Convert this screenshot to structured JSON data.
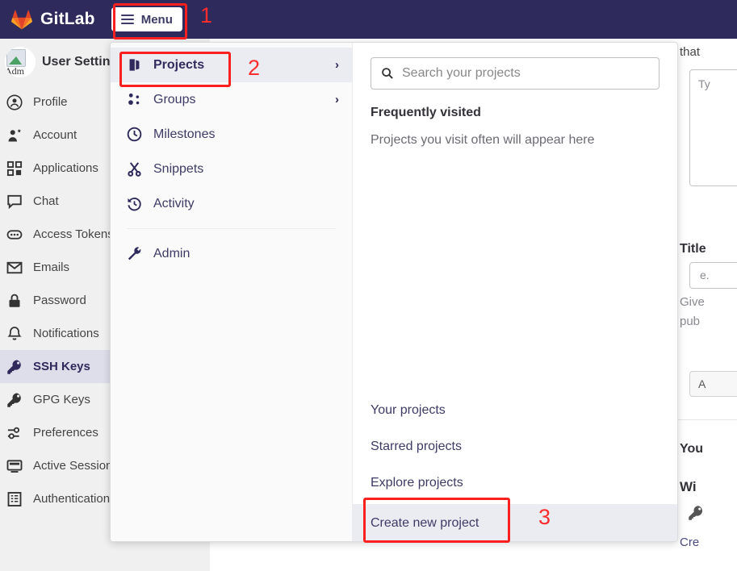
{
  "navbar": {
    "brand": "GitLab",
    "logo_icon": "gitlab-tanuki-icon",
    "menu_label": "Menu",
    "menu_icon": "hamburger-icon",
    "bg_color": "#2e2a5b"
  },
  "annotations": [
    {
      "label": "1",
      "target": "menu-button"
    },
    {
      "label": "2",
      "target": "projects-menu-item"
    },
    {
      "label": "3",
      "target": "create-new-project-link"
    }
  ],
  "sidebar": {
    "title": "User Settings",
    "avatar_alt": "Adm",
    "items": [
      {
        "label": "Profile",
        "icon": "user-circle-icon",
        "active": false
      },
      {
        "label": "Account",
        "icon": "account-gear-icon",
        "active": false
      },
      {
        "label": "Applications",
        "icon": "applications-grid-icon",
        "active": false
      },
      {
        "label": "Chat",
        "icon": "chat-bubble-icon",
        "active": false
      },
      {
        "label": "Access Tokens",
        "icon": "token-icon",
        "active": false
      },
      {
        "label": "Emails",
        "icon": "envelope-icon",
        "active": false
      },
      {
        "label": "Password",
        "icon": "lock-icon",
        "active": false
      },
      {
        "label": "Notifications",
        "icon": "bell-icon",
        "active": false
      },
      {
        "label": "SSH Keys",
        "icon": "key-icon",
        "active": true
      },
      {
        "label": "GPG Keys",
        "icon": "key-icon",
        "active": false
      },
      {
        "label": "Preferences",
        "icon": "sliders-icon",
        "active": false
      },
      {
        "label": "Active Sessions",
        "icon": "monitor-icon",
        "active": false
      },
      {
        "label": "Authentication log",
        "icon": "log-list-icon",
        "active": false
      }
    ]
  },
  "dropdown": {
    "left_items": [
      {
        "label": "Projects",
        "icon": "projects-icon",
        "chevron": "›",
        "selected": true
      },
      {
        "label": "Groups",
        "icon": "groups-icon",
        "chevron": "›",
        "selected": false
      },
      {
        "label": "Milestones",
        "icon": "clock-icon",
        "chevron": "",
        "selected": false
      },
      {
        "label": "Snippets",
        "icon": "scissors-icon",
        "chevron": "",
        "selected": false
      },
      {
        "label": "Activity",
        "icon": "history-icon",
        "chevron": "",
        "selected": false
      }
    ],
    "admin_item": {
      "label": "Admin",
      "icon": "wrench-icon"
    },
    "search": {
      "placeholder": "Search your projects",
      "value": "",
      "icon": "search-icon"
    },
    "frequently_visited_title": "Frequently visited",
    "frequently_visited_empty": "Projects you visit often will appear here",
    "bottom_links": [
      {
        "label": "Your projects",
        "highlighted": false
      },
      {
        "label": "Starred projects",
        "highlighted": false
      },
      {
        "label": "Explore projects",
        "highlighted": false
      }
    ],
    "create_link": {
      "label": "Create new project",
      "highlighted": true
    }
  },
  "page_right": {
    "line_that": "that",
    "textarea_placeholder": "Ty",
    "title_label": "Title",
    "title_placeholder": "e.",
    "help_line1": "Give",
    "help_line2": "pub",
    "button_label": "A",
    "your_heading": "You",
    "wi_heading": "Wi",
    "key_icon": "key-icon",
    "create_text": "Cre"
  },
  "colors": {
    "navbar_bg": "#2e2a5b",
    "sidebar_bg": "#f0f0f0",
    "active_item_bg": "#dedeeb",
    "highlight_red": "#fb1f1f",
    "annotation_red": "#fb2c2c",
    "dropdown_left_bg": "#fafafa",
    "hover_bg": "#ebebf2"
  }
}
